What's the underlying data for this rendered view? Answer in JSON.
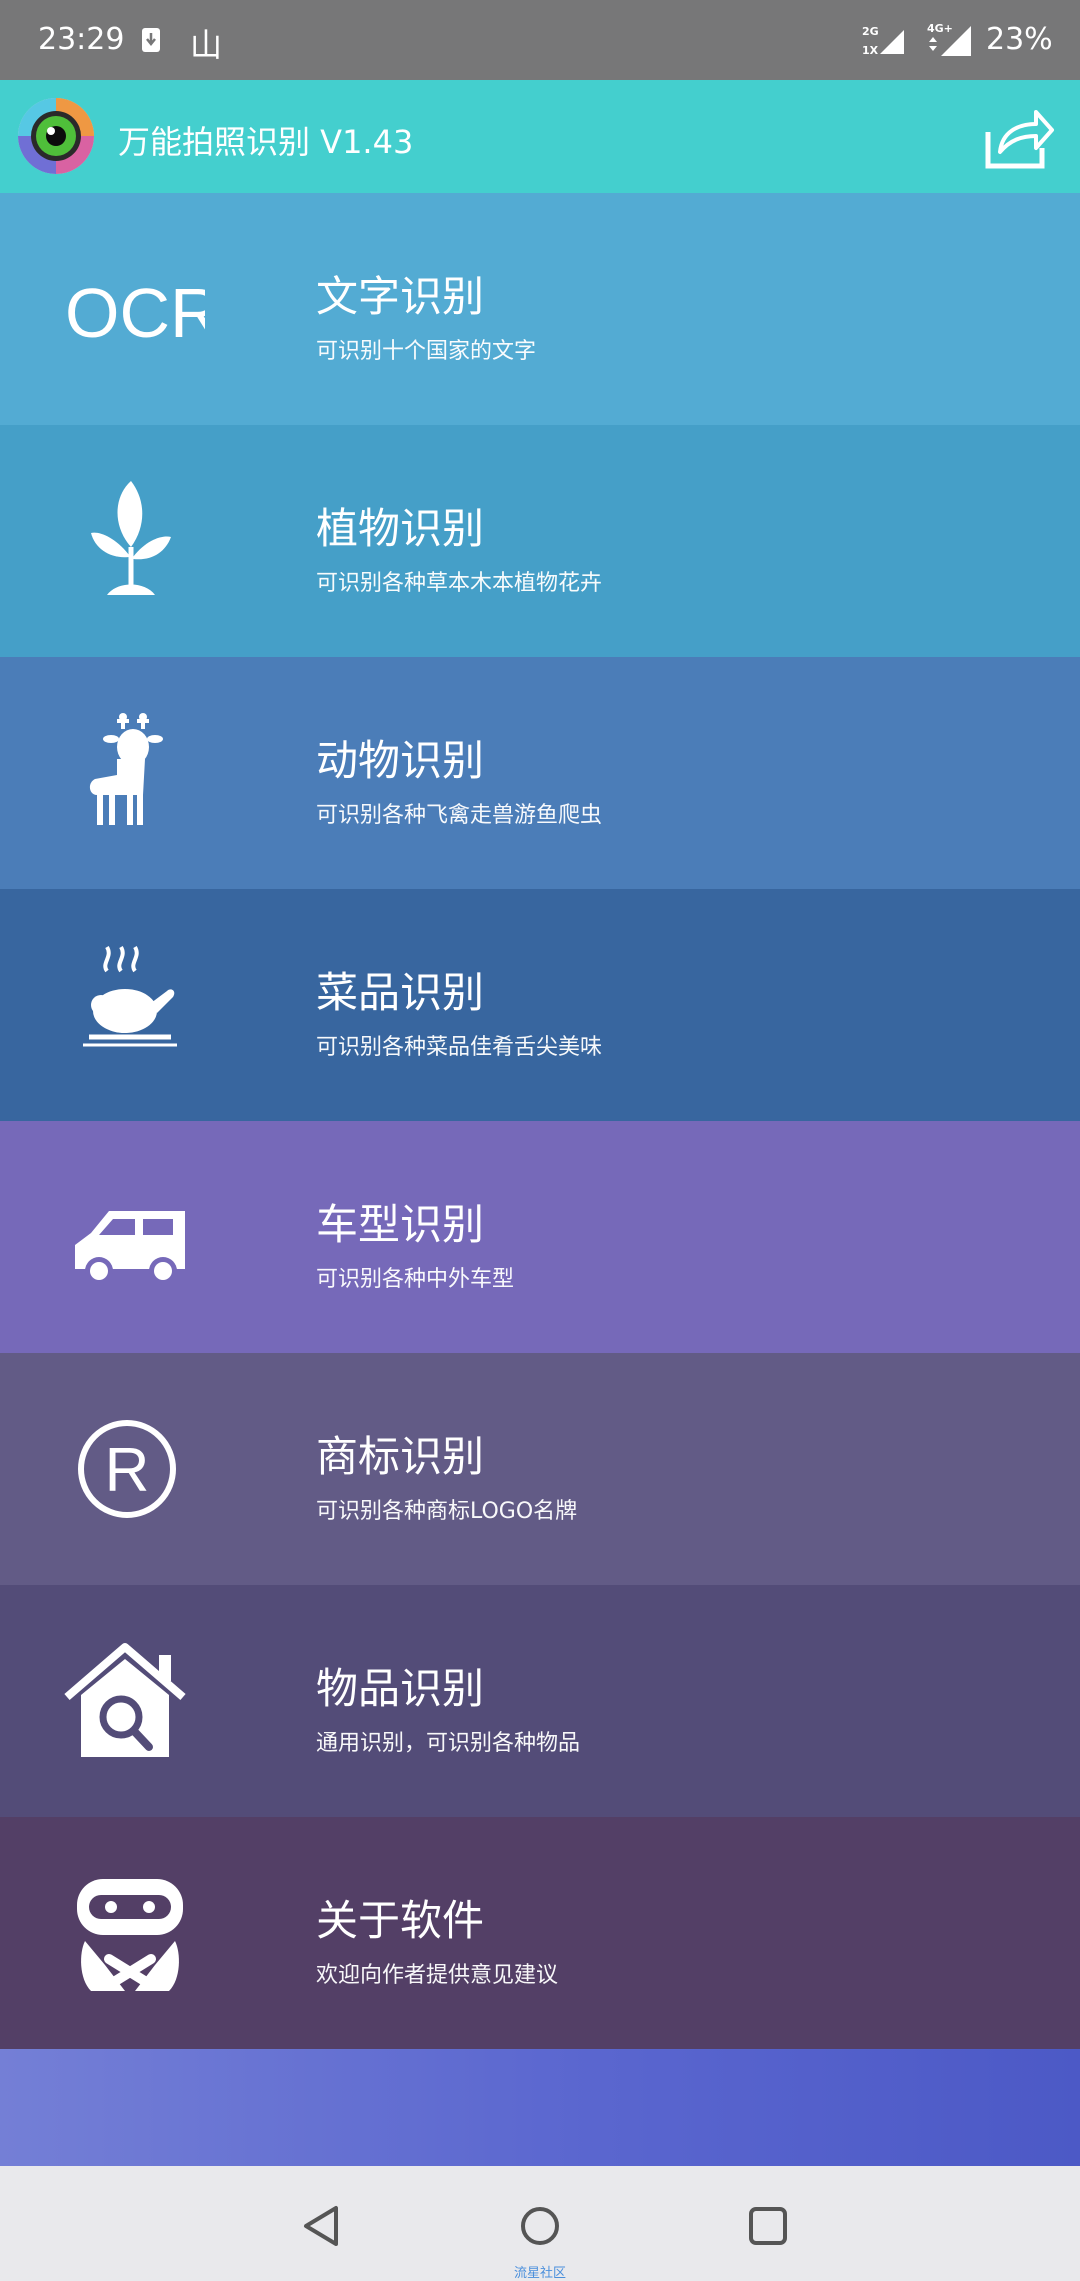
{
  "status_bar": {
    "time": "23:29",
    "carrier_glyph": "山",
    "net_top": "2G",
    "net_bottom": "1X",
    "net_4g": "4G+",
    "battery": "23%"
  },
  "header": {
    "title": "万能拍照识别 V1.43",
    "icons": [
      "eye-logo-icon",
      "share-icon"
    ]
  },
  "menu": {
    "items": [
      {
        "title": "文字识别",
        "desc": "可识别十个国家的文字",
        "icon": "ocr-icon",
        "icon_text": "OCR",
        "bg": "#53abd3"
      },
      {
        "title": "植物识别",
        "desc": "可识别各种草本木本植物花卉",
        "icon": "plant-icon",
        "bg": "#459fc8"
      },
      {
        "title": "动物识别",
        "desc": "可识别各种飞禽走兽游鱼爬虫",
        "icon": "deer-icon",
        "bg": "#4b7db8"
      },
      {
        "title": "菜品识别",
        "desc": "可识别各种菜品佳肴舌尖美味",
        "icon": "dish-icon",
        "bg": "#38669f"
      },
      {
        "title": "车型识别",
        "desc": "可识别各种中外车型",
        "icon": "car-icon",
        "bg": "#7669b9"
      },
      {
        "title": "商标识别",
        "desc": "可识别各种商标LOGO名牌",
        "icon": "registered-icon",
        "icon_text": "R",
        "bg": "#625b86"
      },
      {
        "title": "物品识别",
        "desc": "通用识别，可识别各种物品",
        "icon": "house-search-icon",
        "bg": "#534c78"
      },
      {
        "title": "关于软件",
        "desc": "欢迎向作者提供意见建议",
        "icon": "robot-icon",
        "bg": "#533f66"
      }
    ]
  },
  "nav": {
    "watermark": "流星社区",
    "buttons": [
      "back-icon",
      "home-icon",
      "recents-icon"
    ]
  }
}
